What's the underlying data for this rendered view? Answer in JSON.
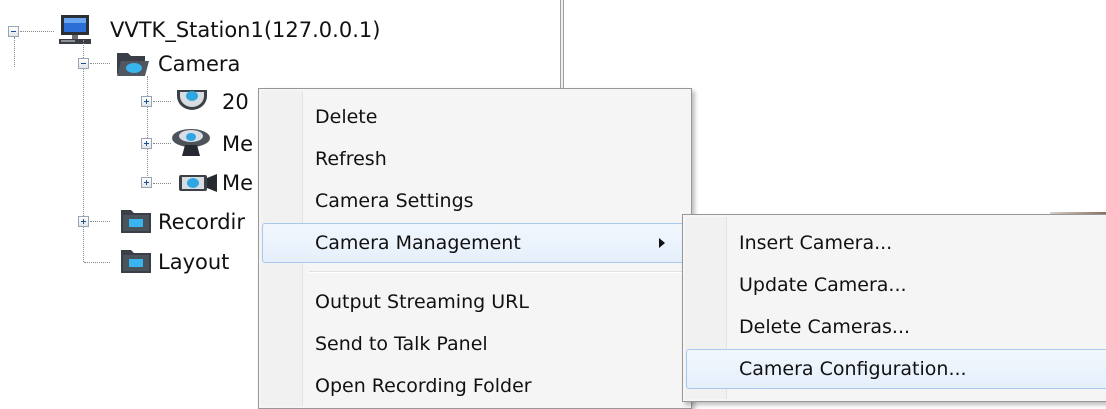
{
  "tree": {
    "station": "VVTK_Station1(127.0.0.1)",
    "camera": "Camera",
    "child1": "20",
    "child2": "Me",
    "child3": "Me",
    "recording": "Recordir",
    "layout": "Layout"
  },
  "context_menu": {
    "items": [
      "Delete",
      "Refresh",
      "Camera Settings",
      "Camera Management",
      "Output Streaming URL",
      "Send to Talk Panel",
      "Open Recording Folder"
    ]
  },
  "submenu": {
    "items": [
      "Insert Camera...",
      "Update Camera...",
      "Delete Cameras...",
      "Camera Configuration..."
    ]
  }
}
